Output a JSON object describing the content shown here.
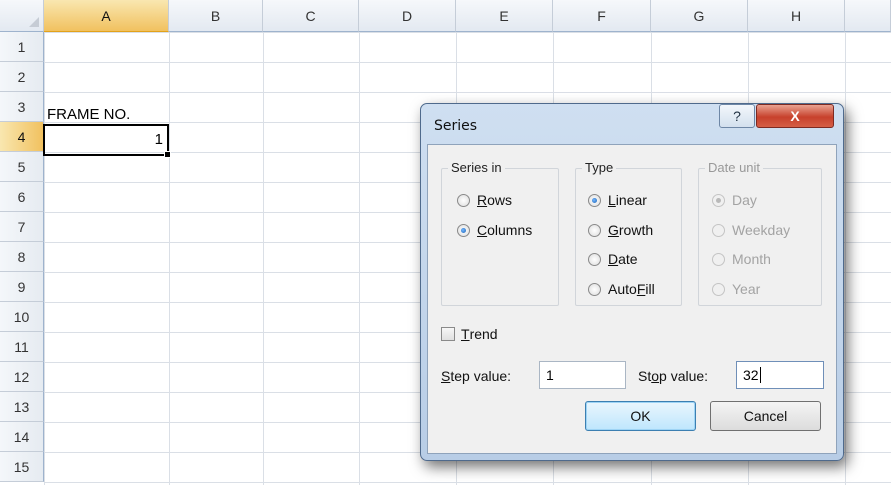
{
  "sheet": {
    "columns": [
      "A",
      "B",
      "C",
      "D",
      "E",
      "F",
      "G",
      "H"
    ],
    "rows": [
      "1",
      "2",
      "3",
      "4",
      "5",
      "6",
      "7",
      "8",
      "9",
      "10",
      "11",
      "12",
      "13",
      "14",
      "15"
    ],
    "active_cell": "A4",
    "cells": {
      "A3": "FRAME NO.",
      "A4": "1"
    }
  },
  "dialog": {
    "title": "Series",
    "help_glyph": "?",
    "close_glyph": "X",
    "series_in": {
      "label": "Series in",
      "options": [
        {
          "label": "Rows",
          "accel": "R",
          "rest": "ows",
          "selected": false
        },
        {
          "label": "Columns",
          "accel": "C",
          "rest": "olumns",
          "selected": true
        }
      ]
    },
    "type": {
      "label": "Type",
      "options": [
        {
          "label": "Linear",
          "accel": "L",
          "rest": "inear",
          "selected": true
        },
        {
          "label": "Growth",
          "accel": "G",
          "rest": "rowth",
          "selected": false
        },
        {
          "label": "Date",
          "accel": "D",
          "rest": "ate",
          "selected": false
        },
        {
          "label": "AutoFill",
          "pre": "Auto",
          "accel": "F",
          "rest": "ill",
          "selected": false
        }
      ]
    },
    "date_unit": {
      "label": "Date unit",
      "enabled": false,
      "options": [
        {
          "label": "Day",
          "selected": true
        },
        {
          "label": "Weekday",
          "selected": false
        },
        {
          "label": "Month",
          "selected": false
        },
        {
          "label": "Year",
          "selected": false
        }
      ]
    },
    "trend": {
      "accel": "T",
      "rest": "rend",
      "checked": false
    },
    "step_value": {
      "pre": "",
      "accel": "S",
      "rest": "tep value:",
      "value": "1"
    },
    "stop_value": {
      "pre": "St",
      "accel": "o",
      "rest": "p value:",
      "value": "32"
    },
    "ok_label": "OK",
    "cancel_label": "Cancel"
  }
}
